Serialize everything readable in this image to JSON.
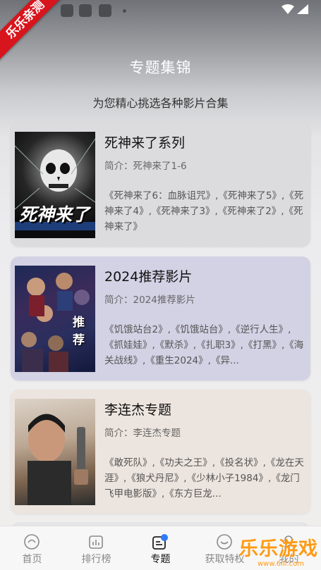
{
  "header": {
    "title": "专题集锦",
    "subtitle": "为您精心挑选各种影片合集"
  },
  "corner_badge": "乐乐亲测",
  "collections": [
    {
      "title": "死神来了系列",
      "intro": "简介：死神来了1-6",
      "films": "《死神来了6：血脉诅咒》,《死神来了5》,《死神来了4》,《死神来了3》,《死神来了2》,《死神来了》",
      "poster_caption": "死神来了"
    },
    {
      "title": "2024推荐影片",
      "intro": "简介：2024推荐影片",
      "films": "《饥饿站台2》,《饥饿站台》,《逆行人生》,《抓娃娃》,《默杀》,《扎职3》,《打黑》,《海关战线》,《重生2024》,《异...",
      "poster_caption": "推荐"
    },
    {
      "title": "李连杰专题",
      "intro": "简介：李连杰专题",
      "films": "《敢死队》,《功夫之王》,《投名状》,《龙在天涯》,《狼犬丹尼》,《少林小子1984》,《龙门飞甲电影版》,《东方巨龙...",
      "poster_caption": ""
    }
  ],
  "tabs": [
    {
      "label": "首页",
      "icon": "home-icon"
    },
    {
      "label": "排行榜",
      "icon": "ranking-icon"
    },
    {
      "label": "专题",
      "icon": "topic-icon",
      "active": true
    },
    {
      "label": "获取特权",
      "icon": "privilege-icon"
    },
    {
      "label": "我的",
      "icon": "profile-icon"
    }
  ],
  "watermark": {
    "text": "乐乐游戏",
    "url": "www.6lll.com"
  },
  "colors": {
    "badge_red": "#d8141c",
    "watermark_orange": "#ff9a14"
  }
}
